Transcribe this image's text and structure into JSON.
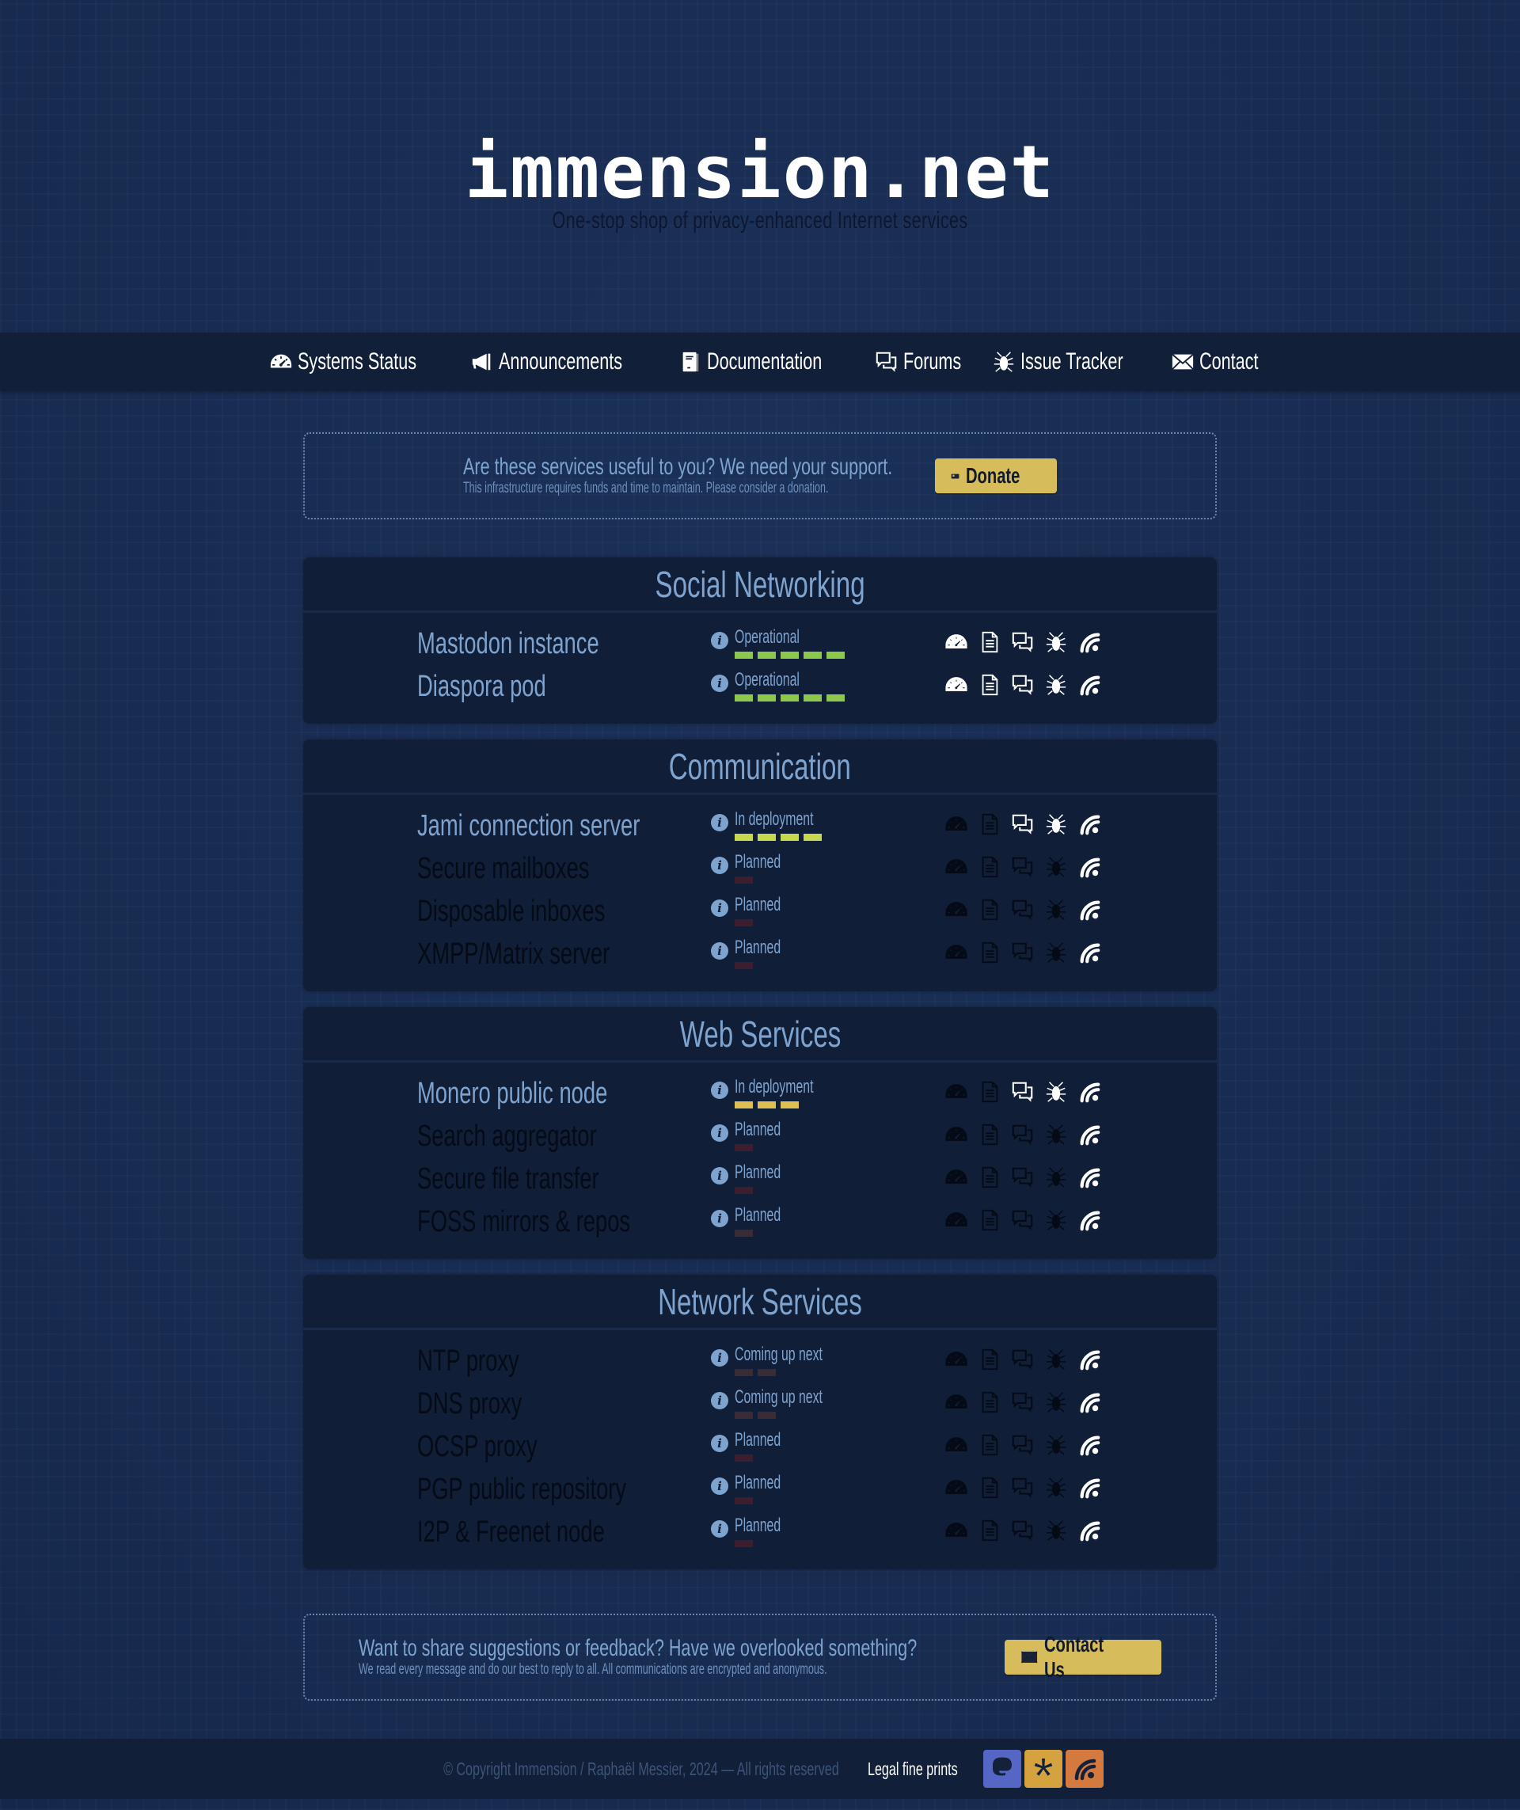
{
  "header": {
    "logo": "immension.net",
    "tagline": "One-stop shop of privacy-enhanced Internet services"
  },
  "nav": {
    "items": [
      {
        "label": "Systems Status",
        "icon": "speedometer-icon"
      },
      {
        "label": "Announcements",
        "icon": "megaphone-icon"
      },
      {
        "label": "Documentation",
        "icon": "book-icon"
      },
      {
        "label": "Forums",
        "icon": "chat-bubbles-icon"
      },
      {
        "label": "Issue Tracker",
        "icon": "bug-icon"
      },
      {
        "label": "Contact",
        "icon": "envelope-icon"
      }
    ]
  },
  "donate_banner": {
    "headline": "Are these services useful to you? We need your support.",
    "subtext": "This infrastructure requires funds and time to maintain. Please consider a donation.",
    "button_label": "Donate",
    "button_icon": "wallet-icon"
  },
  "colors": {
    "operational": "#8cc84b",
    "deployment_green": "#c5d84e",
    "deployment_yellow": "#e0bf52",
    "coming_up": "#3a2b35",
    "planned": "#3d1e2e",
    "accent_button": "#d7bc5c",
    "mastodon": "#5566c4",
    "diaspora": "#d4a23f",
    "rss": "#d57a3e"
  },
  "sections": [
    {
      "title": "Social Networking",
      "services": [
        {
          "name": "Mastodon instance",
          "status": "Operational",
          "level": 5,
          "bar_color": "#8cc84b",
          "active": true,
          "icons": {
            "status": true,
            "docs": true,
            "forum": true,
            "issues": true,
            "feed": true
          }
        },
        {
          "name": "Diaspora pod",
          "status": "Operational",
          "level": 5,
          "bar_color": "#8cc84b",
          "active": true,
          "icons": {
            "status": true,
            "docs": true,
            "forum": true,
            "issues": true,
            "feed": true
          }
        }
      ]
    },
    {
      "title": "Communication",
      "services": [
        {
          "name": "Jami connection server",
          "status": "In deployment",
          "level": 4,
          "bar_color": "#c5d84e",
          "active": true,
          "icons": {
            "status": false,
            "docs": false,
            "forum": true,
            "issues": true,
            "feed": true
          }
        },
        {
          "name": "Secure mailboxes",
          "status": "Planned",
          "level": 1,
          "bar_color": "#3d1e2e",
          "active": false,
          "icons": {
            "status": false,
            "docs": false,
            "forum": false,
            "issues": false,
            "feed": true
          }
        },
        {
          "name": "Disposable inboxes",
          "status": "Planned",
          "level": 1,
          "bar_color": "#3d1e2e",
          "active": false,
          "icons": {
            "status": false,
            "docs": false,
            "forum": false,
            "issues": false,
            "feed": true
          }
        },
        {
          "name": "XMPP/Matrix server",
          "status": "Planned",
          "level": 1,
          "bar_color": "#3d1e2e",
          "active": false,
          "icons": {
            "status": false,
            "docs": false,
            "forum": false,
            "issues": false,
            "feed": true
          }
        }
      ]
    },
    {
      "title": "Web Services",
      "services": [
        {
          "name": "Monero public node",
          "status": "In deployment",
          "level": 3,
          "bar_color": "#e0bf52",
          "active": true,
          "icons": {
            "status": false,
            "docs": false,
            "forum": true,
            "issues": true,
            "feed": true
          }
        },
        {
          "name": "Search aggregator",
          "status": "Planned",
          "level": 1,
          "bar_color": "#3d1e2e",
          "active": false,
          "icons": {
            "status": false,
            "docs": false,
            "forum": false,
            "issues": false,
            "feed": true
          }
        },
        {
          "name": "Secure file transfer",
          "status": "Planned",
          "level": 1,
          "bar_color": "#3d1e2e",
          "active": false,
          "icons": {
            "status": false,
            "docs": false,
            "forum": false,
            "issues": false,
            "feed": true
          }
        },
        {
          "name": "FOSS mirrors & repos",
          "status": "Planned",
          "level": 1,
          "bar_color": "#3a2b35",
          "active": false,
          "icons": {
            "status": false,
            "docs": false,
            "forum": false,
            "issues": false,
            "feed": true
          }
        }
      ]
    },
    {
      "title": "Network Services",
      "services": [
        {
          "name": "NTP proxy",
          "status": "Coming up next",
          "level": 2,
          "bar_color": "#3a2b35",
          "active": false,
          "icons": {
            "status": false,
            "docs": false,
            "forum": false,
            "issues": false,
            "feed": true
          }
        },
        {
          "name": "DNS proxy",
          "status": "Coming up next",
          "level": 2,
          "bar_color": "#3a2b35",
          "active": false,
          "icons": {
            "status": false,
            "docs": false,
            "forum": false,
            "issues": false,
            "feed": true
          }
        },
        {
          "name": "OCSP proxy",
          "status": "Planned",
          "level": 1,
          "bar_color": "#3d1e2e",
          "active": false,
          "icons": {
            "status": false,
            "docs": false,
            "forum": false,
            "issues": false,
            "feed": true
          }
        },
        {
          "name": "PGP public repository",
          "status": "Planned",
          "level": 1,
          "bar_color": "#3d1e2e",
          "active": false,
          "icons": {
            "status": false,
            "docs": false,
            "forum": false,
            "issues": false,
            "feed": true
          }
        },
        {
          "name": "I2P & Freenet node",
          "status": "Planned",
          "level": 1,
          "bar_color": "#3d1e2e",
          "active": false,
          "icons": {
            "status": false,
            "docs": false,
            "forum": false,
            "issues": false,
            "feed": true
          }
        }
      ]
    }
  ],
  "feedback_banner": {
    "headline": "Want to share suggestions or feedback? Have we overlooked something?",
    "subtext": "We read every message and do our best to reply to all. All communications are encrypted and anonymous.",
    "button_label": "Contact Us",
    "button_icon": "envelope-icon"
  },
  "footer": {
    "copyright": "© Copyright Immension / Raphaël Messier, 2024 — All rights reserved",
    "legal_link": "Legal fine prints",
    "social": [
      {
        "name": "mastodon-icon",
        "color": "#5566c4"
      },
      {
        "name": "diaspora-icon",
        "color": "#d4a23f"
      },
      {
        "name": "rss-feed-icon",
        "color": "#d57a3e"
      }
    ]
  }
}
